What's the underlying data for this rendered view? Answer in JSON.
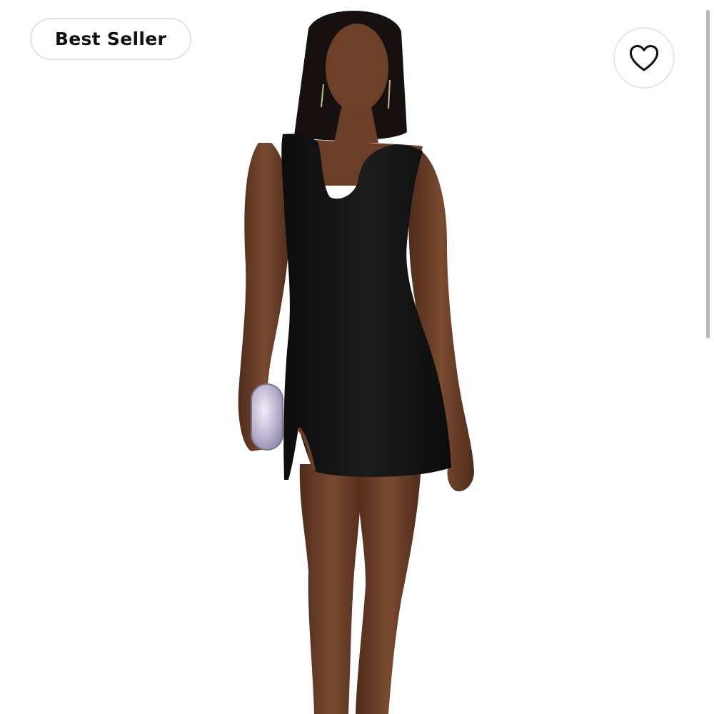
{
  "badge": {
    "label": "Best Seller"
  },
  "favorite": {
    "icon": "heart-outline-icon",
    "selected": false
  },
  "product_image": {
    "icon": "model-black-mini-dress-photo"
  },
  "scrollbar": {
    "visible": true
  },
  "colors": {
    "background": "#ffffff",
    "dress": "#141414",
    "skin": "#6e4029",
    "badge_border": "#e3e3e3",
    "icon": "#111111"
  }
}
